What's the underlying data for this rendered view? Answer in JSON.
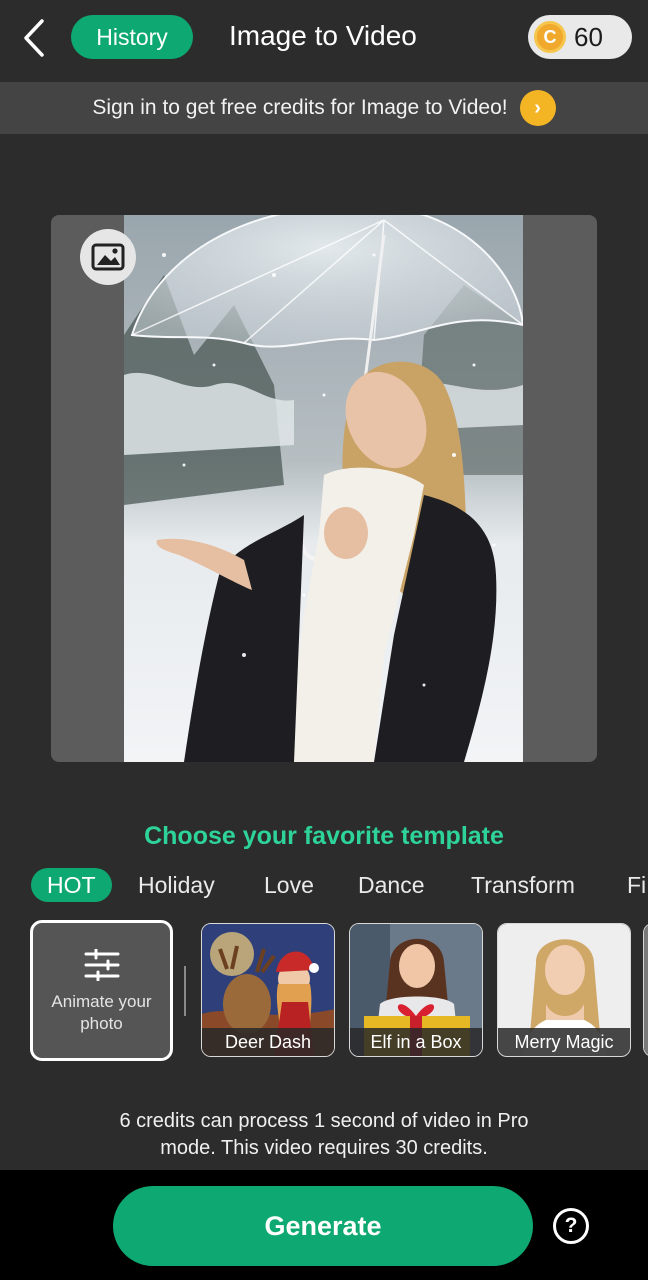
{
  "header": {
    "back_icon": "chevron-left-icon",
    "history_label": "History",
    "title": "Image to Video",
    "coin_icon": "coin-icon",
    "coin_glyph": "C",
    "credits": "60"
  },
  "banner": {
    "text": "Sign in to get free credits for Image to Video!",
    "arrow_glyph": "›",
    "arrow_icon": "chevron-right-icon"
  },
  "preview": {
    "image_icon": "image-icon"
  },
  "templates": {
    "title": "Choose your favorite template",
    "tabs": [
      {
        "label": "HOT",
        "active": true
      },
      {
        "label": "Holiday",
        "active": false
      },
      {
        "label": "Love",
        "active": false
      },
      {
        "label": "Dance",
        "active": false
      },
      {
        "label": "Transform",
        "active": false
      },
      {
        "label": "Fi",
        "active": false
      }
    ],
    "animate_card": {
      "label": "Animate your photo",
      "icon": "sliders-icon"
    },
    "cards": [
      {
        "label": "Deer Dash"
      },
      {
        "label": "Elf in a Box"
      },
      {
        "label": "Merry Magic"
      }
    ]
  },
  "info": {
    "line1": "6 credits can process 1 second of video in Pro",
    "line2": "mode. This video requires 30 credits."
  },
  "bottom": {
    "generate_label": "Generate",
    "help_glyph": "?",
    "help_icon": "question-circle-icon"
  },
  "colors": {
    "accent": "#0ea972",
    "accent_text": "#2ed39a",
    "background": "#2c2c2c",
    "coin": "#f0a92c"
  }
}
